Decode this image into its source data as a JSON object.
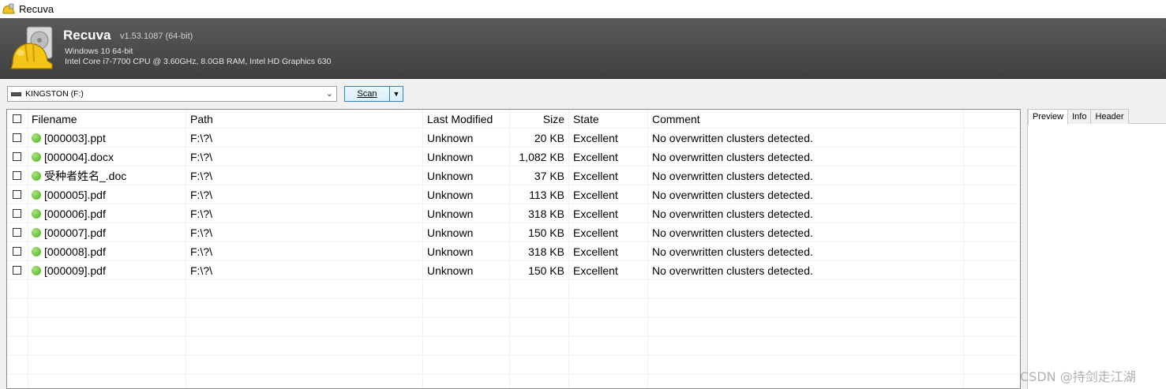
{
  "window": {
    "title": "Recuva"
  },
  "banner": {
    "app_name": "Recuva",
    "version": "v1.53.1087 (64-bit)",
    "os": "Windows 10 64-bit",
    "hardware": "Intel Core i7-7700 CPU @ 3.60GHz, 8.0GB RAM, Intel HD Graphics 630"
  },
  "toolbar": {
    "drive_value": "KINGSTON (F:)",
    "scan_label": "Scan"
  },
  "table": {
    "headers": {
      "filename": "Filename",
      "path": "Path",
      "modified": "Last Modified",
      "size": "Size",
      "state": "State",
      "comment": "Comment"
    },
    "rows": [
      {
        "name": "[000003].ppt",
        "path": "F:\\?\\",
        "modified": "Unknown",
        "size": "20 KB",
        "state": "Excellent",
        "comment": "No overwritten clusters detected."
      },
      {
        "name": "[000004].docx",
        "path": "F:\\?\\",
        "modified": "Unknown",
        "size": "1,082 KB",
        "state": "Excellent",
        "comment": "No overwritten clusters detected."
      },
      {
        "name": "受种者姓名_.doc",
        "path": "F:\\?\\",
        "modified": "Unknown",
        "size": "37 KB",
        "state": "Excellent",
        "comment": "No overwritten clusters detected."
      },
      {
        "name": "[000005].pdf",
        "path": "F:\\?\\",
        "modified": "Unknown",
        "size": "113 KB",
        "state": "Excellent",
        "comment": "No overwritten clusters detected."
      },
      {
        "name": "[000006].pdf",
        "path": "F:\\?\\",
        "modified": "Unknown",
        "size": "318 KB",
        "state": "Excellent",
        "comment": "No overwritten clusters detected."
      },
      {
        "name": "[000007].pdf",
        "path": "F:\\?\\",
        "modified": "Unknown",
        "size": "150 KB",
        "state": "Excellent",
        "comment": "No overwritten clusters detected."
      },
      {
        "name": "[000008].pdf",
        "path": "F:\\?\\",
        "modified": "Unknown",
        "size": "318 KB",
        "state": "Excellent",
        "comment": "No overwritten clusters detected."
      },
      {
        "name": "[000009].pdf",
        "path": "F:\\?\\",
        "modified": "Unknown",
        "size": "150 KB",
        "state": "Excellent",
        "comment": "No overwritten clusters detected."
      }
    ]
  },
  "side_panel": {
    "tabs": [
      "Preview",
      "Info",
      "Header"
    ]
  },
  "watermark": "CSDN @持剑走江湖",
  "colors": {
    "banner": "#4a4a4a",
    "status_excellent": "#4caf1f",
    "scan_border": "#3c7fb1"
  },
  "icons": {
    "app": "recuva-hardhat-icon",
    "drive": "usb-drive-icon",
    "status": "green-status-dot-icon"
  }
}
